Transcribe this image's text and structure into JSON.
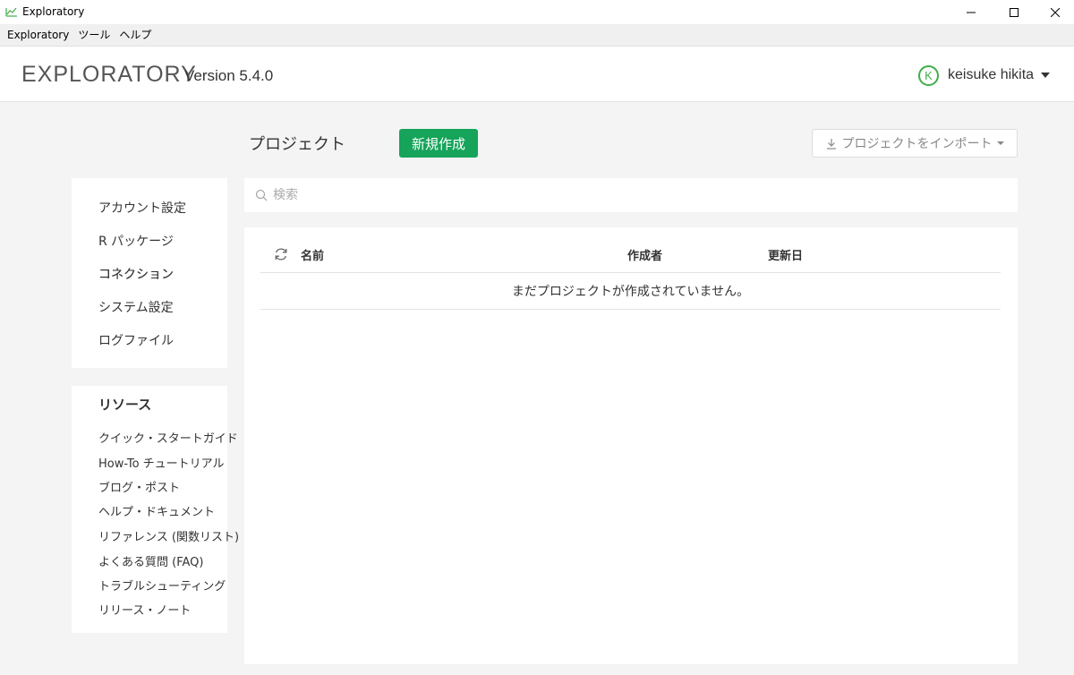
{
  "window": {
    "title": "Exploratory"
  },
  "menubar": {
    "items": [
      "Exploratory",
      "ツール",
      "ヘルプ"
    ]
  },
  "header": {
    "brand": "EXPLORATORY",
    "version": "Version 5.4.0",
    "user": {
      "initial": "K",
      "name": "keisuke hikita"
    }
  },
  "projects": {
    "title": "プロジェクト",
    "new_label": "新規作成",
    "import_label": "プロジェクトをインポート",
    "search_placeholder": "検索",
    "columns": {
      "name": "名前",
      "author": "作成者",
      "updated": "更新日"
    },
    "empty_message": "まだプロジェクトが作成されていません。"
  },
  "sidebar": {
    "settings": [
      "アカウント設定",
      "R パッケージ",
      "コネクション",
      "システム設定",
      "ログファイル"
    ],
    "resources_title": "リソース",
    "resources": [
      "クイック・スタートガイド",
      "How-To チュートリアル",
      "ブログ・ポスト",
      "ヘルプ・ドキュメント",
      "リファレンス (関数リスト)",
      "よくある質問 (FAQ)",
      "トラブルシューティング",
      "リリース・ノート"
    ]
  },
  "colors": {
    "accent_green": "#16a35a",
    "highlight_red": "#e0161e",
    "avatar_green": "#3fae49"
  }
}
